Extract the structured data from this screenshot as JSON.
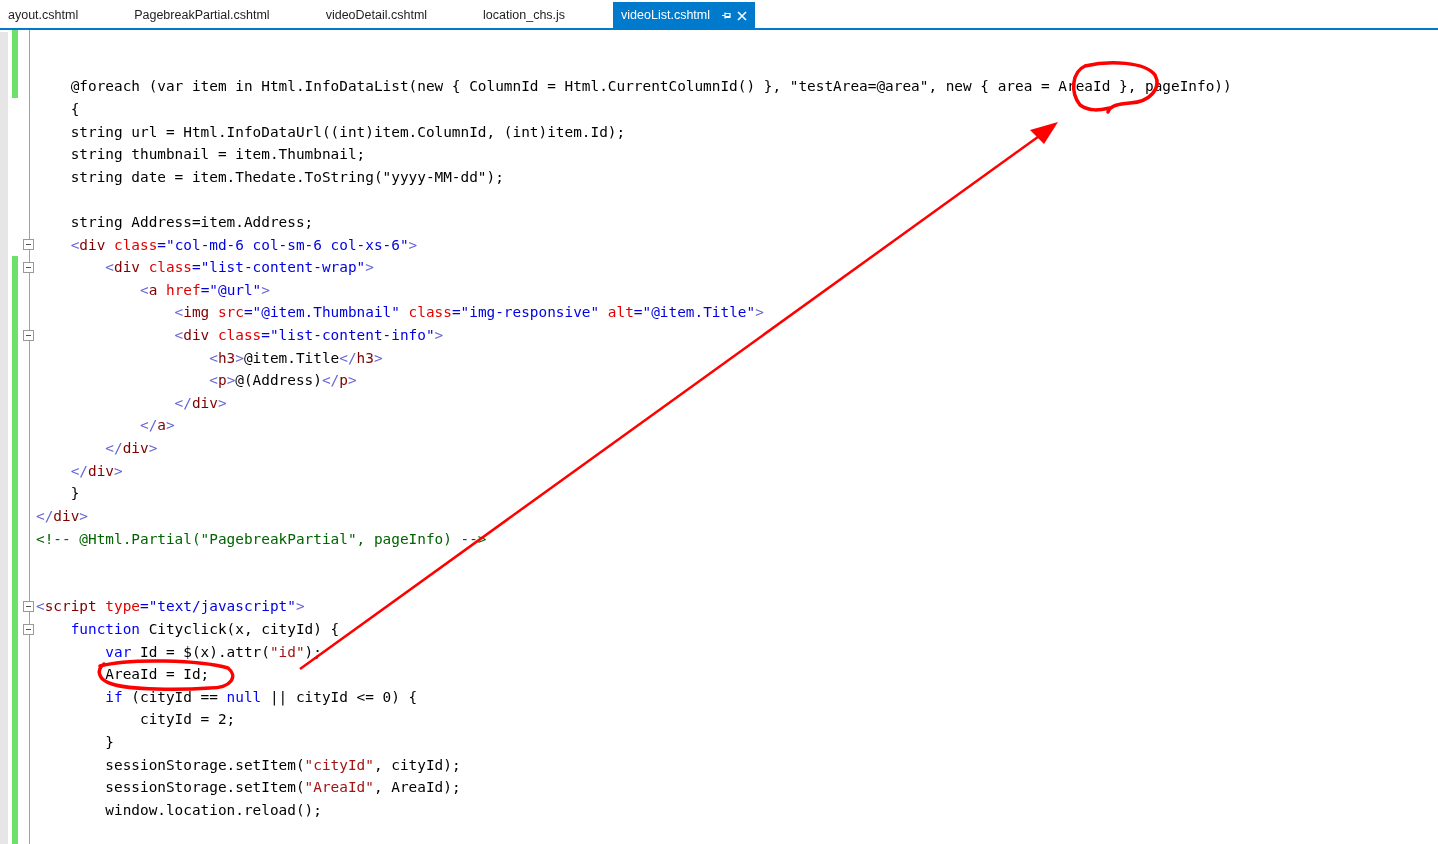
{
  "tabs": [
    {
      "label": "ayout.cshtml",
      "selected": false
    },
    {
      "label": "PagebreakPartial.cshtml",
      "selected": false
    },
    {
      "label": "videoDetail.cshtml",
      "selected": false
    },
    {
      "label": "location_chs.js",
      "selected": false
    },
    {
      "label": "videoList.cshtml",
      "selected": true
    }
  ],
  "lines": [
    {
      "changed": true,
      "fold": false
    },
    {
      "changed": true,
      "fold": false
    },
    {
      "changed": true,
      "fold": false,
      "tokens": [
        {
          "kind": "plain",
          "text": "    @foreach (var item in Html.InfoDataList(new { ColumnId = Html.CurrentColumnId() }, \"testArea=@area\", new { area = AreaId }, pageInfo))"
        }
      ]
    },
    {
      "changed": false,
      "fold": false,
      "tokens": [
        {
          "kind": "plain",
          "text": "    {"
        }
      ]
    },
    {
      "changed": false,
      "fold": false,
      "tokens": [
        {
          "kind": "plain",
          "text": "    string url = Html.InfoDataUrl((int)item.ColumnId, (int)item.Id);"
        }
      ]
    },
    {
      "changed": false,
      "fold": false,
      "tokens": [
        {
          "kind": "plain",
          "text": "    string thumbnail = item.Thumbnail;"
        }
      ]
    },
    {
      "changed": false,
      "fold": false,
      "tokens": [
        {
          "kind": "plain",
          "text": "    string date = item.Thedate.ToString(\"yyyy-MM-dd\");"
        }
      ]
    },
    {
      "changed": false,
      "fold": false
    },
    {
      "changed": false,
      "fold": false,
      "tokens": [
        {
          "kind": "plain",
          "text": "    string Address=item.Address;"
        }
      ]
    },
    {
      "changed": false,
      "fold": true,
      "tokens": [
        {
          "kind": "delim",
          "text": "    <"
        },
        {
          "kind": "elem",
          "text": "div"
        },
        {
          "kind": "attr",
          "text": " class"
        },
        {
          "kind": "value",
          "text": "=\"col-md-6 col-sm-6 col-xs-6\""
        },
        {
          "kind": "delim",
          "text": ">"
        }
      ]
    },
    {
      "changed": true,
      "fold": true,
      "tokens": [
        {
          "kind": "delim",
          "text": "        <"
        },
        {
          "kind": "elem",
          "text": "div"
        },
        {
          "kind": "attr",
          "text": " class"
        },
        {
          "kind": "value",
          "text": "=\"list-content-wrap\""
        },
        {
          "kind": "delim",
          "text": ">"
        }
      ]
    },
    {
      "changed": true,
      "fold": false,
      "tokens": [
        {
          "kind": "delim",
          "text": "            <"
        },
        {
          "kind": "elem",
          "text": "a"
        },
        {
          "kind": "attr",
          "text": " href"
        },
        {
          "kind": "value",
          "text": "=\"@url\""
        },
        {
          "kind": "delim",
          "text": ">"
        }
      ]
    },
    {
      "changed": true,
      "fold": false,
      "tokens": [
        {
          "kind": "delim",
          "text": "                <"
        },
        {
          "kind": "elem",
          "text": "img"
        },
        {
          "kind": "attr",
          "text": " src"
        },
        {
          "kind": "value",
          "text": "=\"@item.Thumbnail\""
        },
        {
          "kind": "attr",
          "text": " class"
        },
        {
          "kind": "value",
          "text": "=\"img-responsive\""
        },
        {
          "kind": "attr",
          "text": " alt"
        },
        {
          "kind": "value",
          "text": "=\"@item.Title\""
        },
        {
          "kind": "delim",
          "text": ">"
        }
      ]
    },
    {
      "changed": true,
      "fold": true,
      "tokens": [
        {
          "kind": "delim",
          "text": "                <"
        },
        {
          "kind": "elem",
          "text": "div"
        },
        {
          "kind": "attr",
          "text": " class"
        },
        {
          "kind": "value",
          "text": "=\"list-content-info\""
        },
        {
          "kind": "delim",
          "text": ">"
        }
      ]
    },
    {
      "changed": true,
      "fold": false,
      "tokens": [
        {
          "kind": "delim",
          "text": "                    <"
        },
        {
          "kind": "elem",
          "text": "h3"
        },
        {
          "kind": "delim",
          "text": ">"
        },
        {
          "kind": "plain",
          "text": "@item.Title"
        },
        {
          "kind": "delim",
          "text": "</"
        },
        {
          "kind": "elem",
          "text": "h3"
        },
        {
          "kind": "delim",
          "text": ">"
        }
      ]
    },
    {
      "changed": true,
      "fold": false,
      "tokens": [
        {
          "kind": "delim",
          "text": "                    <"
        },
        {
          "kind": "elem",
          "text": "p"
        },
        {
          "kind": "delim",
          "text": ">"
        },
        {
          "kind": "plain",
          "text": "@(Address)"
        },
        {
          "kind": "delim",
          "text": "</"
        },
        {
          "kind": "elem",
          "text": "p"
        },
        {
          "kind": "delim",
          "text": ">"
        }
      ]
    },
    {
      "changed": true,
      "fold": false,
      "tokens": [
        {
          "kind": "delim",
          "text": "                </"
        },
        {
          "kind": "elem",
          "text": "div"
        },
        {
          "kind": "delim",
          "text": ">"
        }
      ]
    },
    {
      "changed": true,
      "fold": false,
      "tokens": [
        {
          "kind": "delim",
          "text": "            </"
        },
        {
          "kind": "elem",
          "text": "a"
        },
        {
          "kind": "delim",
          "text": ">"
        }
      ]
    },
    {
      "changed": true,
      "fold": false,
      "tokens": [
        {
          "kind": "delim",
          "text": "        </"
        },
        {
          "kind": "elem",
          "text": "div"
        },
        {
          "kind": "delim",
          "text": ">"
        }
      ]
    },
    {
      "changed": true,
      "fold": false,
      "tokens": [
        {
          "kind": "delim",
          "text": "    </"
        },
        {
          "kind": "elem",
          "text": "div"
        },
        {
          "kind": "delim",
          "text": ">"
        }
      ]
    },
    {
      "changed": true,
      "fold": false,
      "tokens": [
        {
          "kind": "plain",
          "text": "    }"
        }
      ]
    },
    {
      "changed": true,
      "fold": false,
      "tokens": [
        {
          "kind": "delim",
          "text": "</"
        },
        {
          "kind": "elem",
          "text": "div"
        },
        {
          "kind": "delim",
          "text": ">"
        }
      ]
    },
    {
      "changed": true,
      "fold": false,
      "tokens": [
        {
          "kind": "comment",
          "text": "<!-- @Html.Partial(\"PagebreakPartial\", pageInfo) -->"
        }
      ]
    },
    {
      "changed": true,
      "fold": false
    },
    {
      "changed": true,
      "fold": false
    },
    {
      "changed": true,
      "fold": true,
      "tokens": [
        {
          "kind": "delim",
          "text": "<"
        },
        {
          "kind": "elem",
          "text": "script"
        },
        {
          "kind": "attr",
          "text": " type"
        },
        {
          "kind": "value",
          "text": "=\"text/javascript\""
        },
        {
          "kind": "delim",
          "text": ">"
        }
      ]
    },
    {
      "changed": true,
      "fold": true,
      "tokens": [
        {
          "kind": "keyword",
          "text": "    function"
        },
        {
          "kind": "plain",
          "text": " Cityclick(x, cityId) {"
        }
      ]
    },
    {
      "changed": true,
      "fold": false,
      "tokens": [
        {
          "kind": "keyword",
          "text": "        var"
        },
        {
          "kind": "plain",
          "text": " Id = $(x).attr("
        },
        {
          "kind": "string",
          "text": "\"id\""
        },
        {
          "kind": "plain",
          "text": ");"
        }
      ]
    },
    {
      "changed": true,
      "fold": false,
      "tokens": [
        {
          "kind": "plain",
          "text": "        AreaId = Id;"
        }
      ]
    },
    {
      "changed": true,
      "fold": false,
      "tokens": [
        {
          "kind": "keyword",
          "text": "        if"
        },
        {
          "kind": "plain",
          "text": " (cityId == "
        },
        {
          "kind": "keyword",
          "text": "null"
        },
        {
          "kind": "plain",
          "text": " || cityId <= 0) {"
        }
      ]
    },
    {
      "changed": true,
      "fold": false,
      "tokens": [
        {
          "kind": "plain",
          "text": "            cityId = 2;"
        }
      ]
    },
    {
      "changed": true,
      "fold": false,
      "tokens": [
        {
          "kind": "plain",
          "text": "        }"
        }
      ]
    },
    {
      "changed": true,
      "fold": false,
      "tokens": [
        {
          "kind": "plain",
          "text": "        sessionStorage.setItem("
        },
        {
          "kind": "string",
          "text": "\"cityId\""
        },
        {
          "kind": "plain",
          "text": ", cityId);"
        }
      ]
    },
    {
      "changed": true,
      "fold": false,
      "tokens": [
        {
          "kind": "plain",
          "text": "        sessionStorage.setItem("
        },
        {
          "kind": "string",
          "text": "\"AreaId\""
        },
        {
          "kind": "plain",
          "text": ", AreaId);"
        }
      ]
    },
    {
      "changed": true,
      "fold": false,
      "tokens": [
        {
          "kind": "plain",
          "text": "        window.location.reload();"
        }
      ]
    },
    {
      "changed": true,
      "fold": false
    }
  ]
}
